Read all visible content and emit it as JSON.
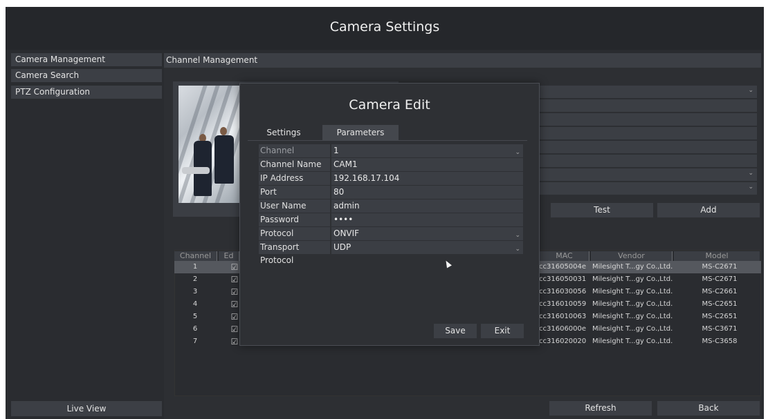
{
  "window": {
    "title": "Camera Settings"
  },
  "sidebar": {
    "items": [
      {
        "label": "Camera Management"
      },
      {
        "label": "Camera Search"
      },
      {
        "label": "PTZ Configuration"
      }
    ],
    "live_view": "Live View"
  },
  "main": {
    "header": "Channel Management",
    "buttons": {
      "test": "Test",
      "add": "Add",
      "refresh": "Refresh",
      "back": "Back"
    },
    "table": {
      "columns": [
        "Channel",
        "Ed",
        "MAC",
        "Vendor",
        "Model"
      ],
      "rows": [
        {
          "channel": "1",
          "mac": "cc31605004e",
          "vendor": "Milesight T...gy Co.,Ltd.",
          "model": "MS-C2671"
        },
        {
          "channel": "2",
          "mac": "cc316050031",
          "vendor": "Milesight T...gy Co.,Ltd.",
          "model": "MS-C2671"
        },
        {
          "channel": "3",
          "mac": "cc316030056",
          "vendor": "Milesight T...gy Co.,Ltd.",
          "model": "MS-C2661"
        },
        {
          "channel": "4",
          "mac": "cc316010059",
          "vendor": "Milesight T...gy Co.,Ltd.",
          "model": "MS-C2651"
        },
        {
          "channel": "5",
          "mac": "cc316010063",
          "vendor": "Milesight T...gy Co.,Ltd.",
          "model": "MS-C2651"
        },
        {
          "channel": "6",
          "mac": "cc31606000e",
          "vendor": "Milesight T...gy Co.,Ltd.",
          "model": "MS-C3671"
        },
        {
          "channel": "7",
          "mac": "cc316020020",
          "vendor": "Milesight T...gy Co.,Ltd.",
          "model": "MS-C3658"
        }
      ],
      "selected_row": "1"
    }
  },
  "dialog": {
    "title": "Camera Edit",
    "tabs": [
      {
        "label": "Settings"
      },
      {
        "label": "Parameters"
      }
    ],
    "fields": {
      "channel": {
        "label": "Channel",
        "value": "1"
      },
      "channel_name": {
        "label": "Channel Name",
        "value": "CAM1"
      },
      "ip_address": {
        "label": "IP Address",
        "value": "192.168.17.104"
      },
      "port": {
        "label": "Port",
        "value": "80"
      },
      "user_name": {
        "label": "User Name",
        "value": "admin"
      },
      "password": {
        "label": "Password",
        "value": "••••"
      },
      "protocol": {
        "label": "Protocol",
        "value": "ONVIF"
      },
      "transport_protocol": {
        "label": "Transport Protocol",
        "value": "UDP"
      }
    },
    "buttons": {
      "save": "Save",
      "exit": "Exit"
    }
  },
  "icons": {
    "dropdown": "chevron-down-icon",
    "edit": "edit-icon",
    "cursor": "mouse-cursor-icon"
  },
  "colors": {
    "background": "#2a2c30",
    "panel": "#3c3f45",
    "selected_row": "#55585e",
    "text": "#e8e8e8"
  }
}
